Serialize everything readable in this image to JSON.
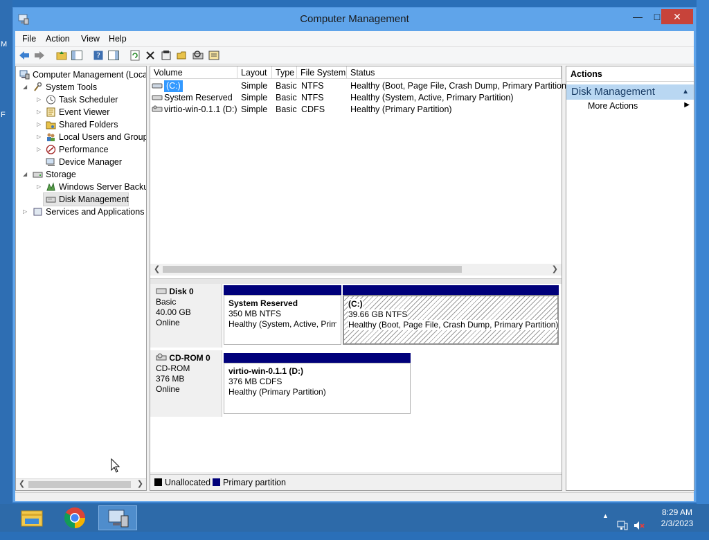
{
  "window": {
    "title": "Computer Management"
  },
  "menu": [
    "File",
    "Action",
    "View",
    "Help"
  ],
  "tree": [
    {
      "label": "Computer Management (Local",
      "icon": "computer-icon"
    },
    {
      "label": "System Tools",
      "icon": "tools-icon"
    },
    {
      "label": "Task Scheduler",
      "icon": "clock-icon"
    },
    {
      "label": "Event Viewer",
      "icon": "event-viewer-icon"
    },
    {
      "label": "Shared Folders",
      "icon": "shared-folder-icon"
    },
    {
      "label": "Local Users and Groups",
      "icon": "users-icon"
    },
    {
      "label": "Performance",
      "icon": "performance-icon"
    },
    {
      "label": "Device Manager",
      "icon": "device-manager-icon"
    },
    {
      "label": "Storage",
      "icon": "storage-icon"
    },
    {
      "label": "Windows Server Backup",
      "icon": "backup-icon"
    },
    {
      "label": "Disk Management",
      "icon": "disk-icon"
    },
    {
      "label": "Services and Applications",
      "icon": "services-icon"
    }
  ],
  "volume_table": {
    "headers": [
      "Volume",
      "Layout",
      "Type",
      "File System",
      "Status"
    ],
    "rows": [
      [
        "(C:)",
        "Simple",
        "Basic",
        "NTFS",
        "Healthy (Boot, Page File, Crash Dump, Primary Partition)"
      ],
      [
        "System Reserved",
        "Simple",
        "Basic",
        "NTFS",
        "Healthy (System, Active, Primary Partition)"
      ],
      [
        "virtio-win-0.1.1 (D:)",
        "Simple",
        "Basic",
        "CDFS",
        "Healthy (Primary Partition)"
      ]
    ]
  },
  "disks": [
    {
      "name": "Disk 0",
      "kind": "Basic",
      "size": "40.00 GB",
      "state": "Online",
      "partitions": [
        {
          "name": "System Reserved",
          "size": "350 MB NTFS",
          "status": "Healthy (System, Active, Prim"
        },
        {
          "name": "(C:)",
          "size": "39.66 GB NTFS",
          "status": "Healthy (Boot, Page File, Crash Dump, Primary Partition)"
        }
      ]
    },
    {
      "name": "CD-ROM 0",
      "kind": "CD-ROM",
      "size": "376 MB",
      "state": "Online",
      "partitions": [
        {
          "name": "virtio-win-0.1.1  (D:)",
          "size": "376 MB CDFS",
          "status": "Healthy (Primary Partition)"
        }
      ]
    }
  ],
  "legend": {
    "unallocated": "Unallocated",
    "primary": "Primary partition"
  },
  "colors": {
    "unallocated": "#000000",
    "primary": "#00007a",
    "actions_section": "#b9d7f2"
  },
  "actions": {
    "header": "Actions",
    "section": "Disk Management",
    "more": "More Actions"
  },
  "taskbar": {
    "time": "8:29 AM",
    "date": "2/3/2023",
    "apps": [
      "file-explorer-icon",
      "chrome-icon",
      "server-manager-icon"
    ]
  }
}
